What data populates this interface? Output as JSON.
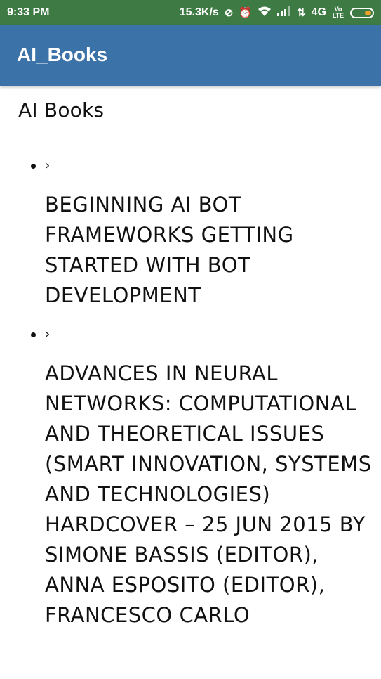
{
  "status_bar": {
    "time": "9:33 PM",
    "speed": "15.3K/s",
    "network": "4G",
    "lte_badge": "Vo LTE",
    "icons": [
      "sync-off-icon",
      "alarm-icon",
      "wifi-icon",
      "signal-icon",
      "data-arrows-icon",
      "battery-icon"
    ],
    "colors": {
      "background": "#3d7a44",
      "battery_accent": "#f2a22a"
    }
  },
  "app_bar": {
    "title": "AI_Books",
    "color": "#3b73a8"
  },
  "page": {
    "title": "AI Books"
  },
  "books": [
    {
      "expander": "›",
      "title": "Beginning AI Bot Frameworks Getting Started with Bot Development"
    },
    {
      "expander": "›",
      "title": "Advances in Neural Networks: Computational and Theoretical Issues (Smart Innovation, Systems and Technologies) Hardcover – 25 Jun 2015 by Simone Bassis (Editor), Anna Esposito (Editor), Francesco Carlo"
    }
  ]
}
